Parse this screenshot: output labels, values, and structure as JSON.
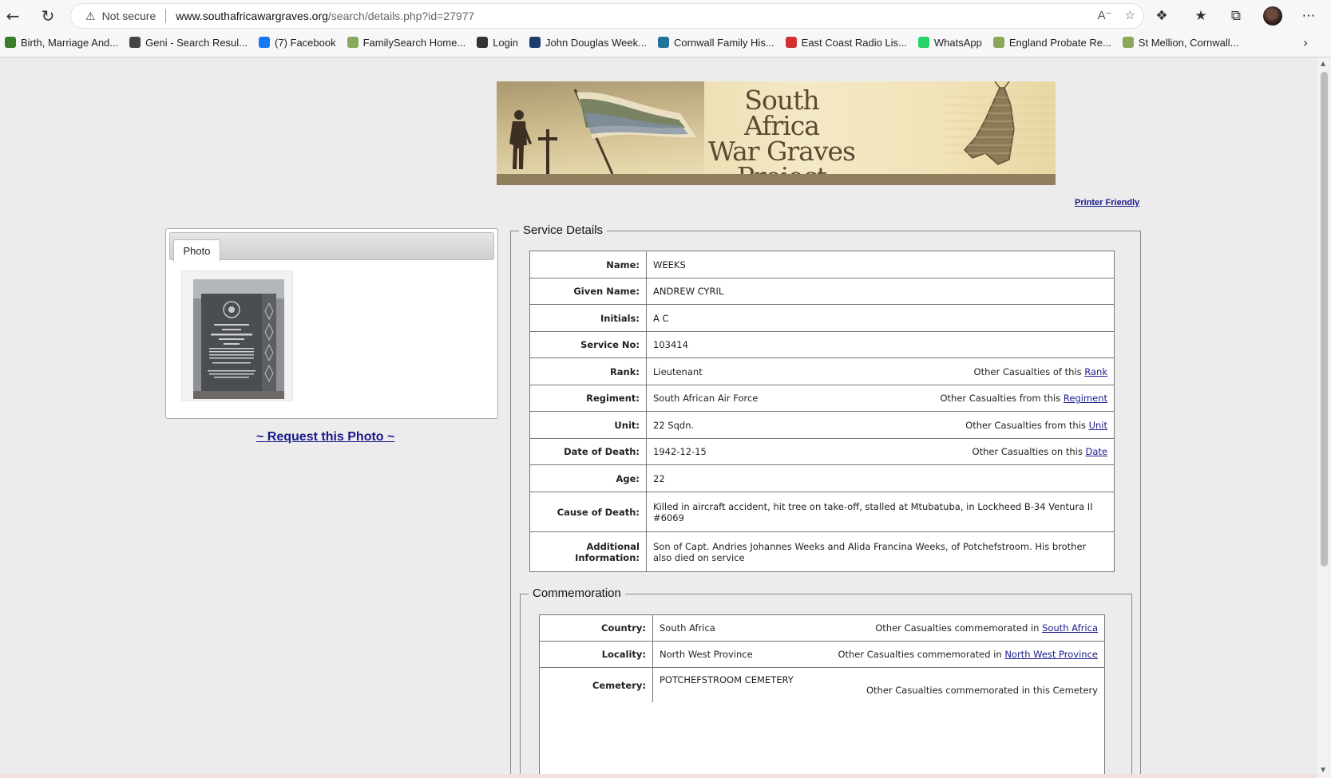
{
  "browser": {
    "security_label": "Not secure",
    "url_host": "www.southafricawargraves.org",
    "url_path": "/search/details.php?id=27977",
    "bookmarks": [
      {
        "label": "Birth, Marriage And...",
        "icon": "tree-icon",
        "color": "#3a7d2c"
      },
      {
        "label": "Geni - Search Resul...",
        "icon": "geni-g-icon",
        "color": "#444"
      },
      {
        "label": "(7) Facebook",
        "icon": "facebook-icon",
        "color": "#1877f2"
      },
      {
        "label": "FamilySearch Home...",
        "icon": "familysearch-tree-icon",
        "color": "#8aa85a"
      },
      {
        "label": "Login",
        "icon": "login-figure-icon",
        "color": "#333"
      },
      {
        "label": "John Douglas Week...",
        "icon": "ancestry-leaf-icon",
        "color": "#1a3d6e"
      },
      {
        "label": "Cornwall Family His...",
        "icon": "wordpress-icon",
        "color": "#21759b"
      },
      {
        "label": "East Coast Radio Lis...",
        "icon": "sa-flag-icon",
        "color": "#d32f2f"
      },
      {
        "label": "WhatsApp",
        "icon": "whatsapp-icon",
        "color": "#25d366"
      },
      {
        "label": "England Probate Re...",
        "icon": "familysearch-tree-icon",
        "color": "#8aa85a"
      },
      {
        "label": "St Mellion, Cornwall...",
        "icon": "familysearch-tree-icon",
        "color": "#8aa85a"
      }
    ]
  },
  "banner": {
    "title_line1": "South Africa",
    "title_line2": "War Graves",
    "title_line3": "Project"
  },
  "printer_friendly": "Printer Friendly",
  "photo_panel": {
    "tab_label": "Photo",
    "request_link": "~ Request this Photo ~"
  },
  "service_details": {
    "legend": "Service Details",
    "rows": [
      {
        "label": "Name:",
        "value": "WEEKS"
      },
      {
        "label": "Given Name:",
        "value": "ANDREW CYRIL"
      },
      {
        "label": "Initials:",
        "value": "A C"
      },
      {
        "label": "Service No:",
        "value": "103414"
      },
      {
        "label": "Rank:",
        "value": "Lieutenant",
        "other_text": "Other Casualties of this",
        "other_link": "Rank"
      },
      {
        "label": "Regiment:",
        "value": "South African Air Force",
        "other_text": "Other Casualties from this",
        "other_link": "Regiment"
      },
      {
        "label": "Unit:",
        "value": "22 Sqdn.",
        "other_text": "Other Casualties from this",
        "other_link": "Unit"
      },
      {
        "label": "Date of Death:",
        "value": "1942-12-15",
        "other_text": "Other Casualties on this",
        "other_link": "Date"
      },
      {
        "label": "Age:",
        "value": "22"
      },
      {
        "label": "Cause of Death:",
        "value": "Killed in aircraft accident, hit tree on take-off, stalled at Mtubatuba, in Lockheed B-34 Ventura II #6069"
      },
      {
        "label": "Additional Information:",
        "value": "Son of Capt. Andries Johannes Weeks and Alida Francina Weeks, of Potchefstroom. His brother also died on service"
      }
    ]
  },
  "commemoration": {
    "legend": "Commemoration",
    "rows": [
      {
        "label": "Country:",
        "value": "South Africa",
        "other_text": "Other Casualties commemorated in",
        "other_link": "South Africa"
      },
      {
        "label": "Locality:",
        "value": "North West Province",
        "other_text": "Other Casualties commemorated in",
        "other_link": "North West Province"
      },
      {
        "label": "Cemetery:",
        "value": "POTCHEFSTROOM CEMETERY",
        "other_text": "Other Casualties commemorated in this",
        "other_link": "Cemetery"
      }
    ]
  }
}
